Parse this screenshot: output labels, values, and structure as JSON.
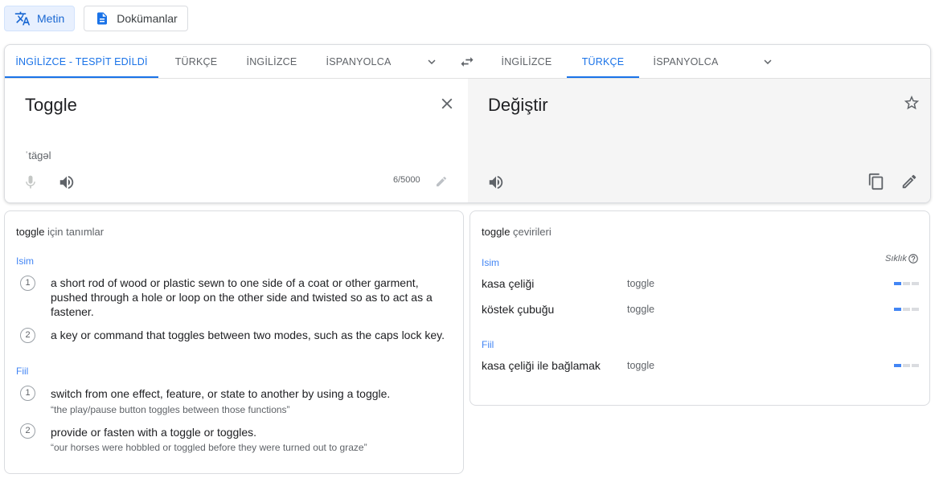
{
  "modes": [
    {
      "label": "Metin",
      "icon": "translate-icon",
      "active": true
    },
    {
      "label": "Dokümanlar",
      "icon": "document-icon",
      "active": false
    }
  ],
  "source_tabs": [
    {
      "label": "İNGİLİZCE - TESPİT EDİLDİ",
      "active": true
    },
    {
      "label": "TÜRKÇE",
      "active": false
    },
    {
      "label": "İNGİLİZCE",
      "active": false
    },
    {
      "label": "İSPANYOLCA",
      "active": false
    }
  ],
  "target_tabs": [
    {
      "label": "İNGİLİZCE",
      "active": false
    },
    {
      "label": "TÜRKÇE",
      "active": true
    },
    {
      "label": "İSPANYOLCA",
      "active": false
    }
  ],
  "source": {
    "text": "Toggle",
    "transliteration": "ˈtägəl",
    "char_count": "6/5000"
  },
  "target": {
    "text": "Değiştir"
  },
  "definitions": {
    "word": "toggle",
    "suffix": " için tanımlar",
    "groups": [
      {
        "pos": "Isim",
        "items": [
          {
            "num": "1",
            "text": "a short rod of wood or plastic sewn to one side of a coat or other garment, pushed through a hole or loop on the other side and twisted so as to act as a fastener.",
            "example": ""
          },
          {
            "num": "2",
            "text": "a key or command that toggles between two modes, such as the caps lock key.",
            "example": ""
          }
        ]
      },
      {
        "pos": "Fiil",
        "items": [
          {
            "num": "1",
            "text": "switch from one effect, feature, or state to another by using a toggle.",
            "example": "“the play/pause button toggles between those functions”"
          },
          {
            "num": "2",
            "text": "provide or fasten with a toggle or toggles.",
            "example": "“our horses were hobbled or toggled before they were turned out to graze”"
          }
        ]
      }
    ]
  },
  "translations": {
    "word": "toggle",
    "suffix": " çevirileri",
    "frequency_label": "Sıklık",
    "groups": [
      {
        "pos": "Isim",
        "rows": [
          {
            "translation": "kasa çeliği",
            "synonyms": "toggle",
            "frequency_bars": 1
          },
          {
            "translation": "köstek çubuğu",
            "synonyms": "toggle",
            "frequency_bars": 1
          }
        ]
      },
      {
        "pos": "Fiil",
        "rows": [
          {
            "translation": "kasa çeliği ile bağlamak",
            "synonyms": "toggle",
            "frequency_bars": 1
          }
        ]
      }
    ]
  },
  "colors": {
    "accent": "#1a73e8",
    "freq_on": "#4285f4",
    "freq_off": "#dadce0",
    "target_bg": "#f5f5f5"
  }
}
